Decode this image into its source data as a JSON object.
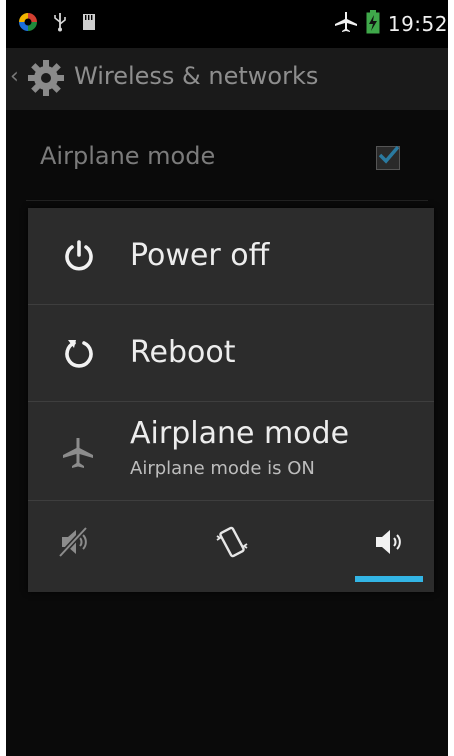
{
  "status_bar": {
    "time": "19:52",
    "icons": [
      "app-icon",
      "usb-icon",
      "sd-card-icon",
      "airplane-icon",
      "battery-charging-icon"
    ]
  },
  "action_bar": {
    "title": "Wireless & networks",
    "icon": "settings-gear-icon"
  },
  "background": {
    "setting_label": "Airplane mode",
    "checked": true
  },
  "dialog": {
    "items": [
      {
        "label": "Power off",
        "icon": "power-icon"
      },
      {
        "label": "Reboot",
        "icon": "reboot-icon"
      },
      {
        "label": "Airplane mode",
        "sublabel": "Airplane mode is ON",
        "icon": "airplane-icon"
      }
    ],
    "sound_modes": [
      {
        "name": "silent",
        "icon": "silent-icon",
        "selected": false
      },
      {
        "name": "vibrate",
        "icon": "vibrate-icon",
        "selected": false
      },
      {
        "name": "sound-on",
        "icon": "volume-icon",
        "selected": true
      }
    ],
    "accent_color": "#33b5e5"
  }
}
